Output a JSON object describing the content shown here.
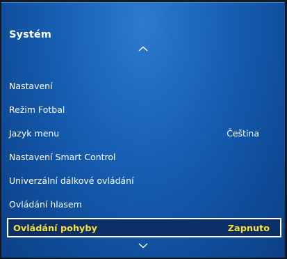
{
  "menu": {
    "title": "Systém",
    "items": [
      {
        "label": "Nastavení",
        "value": ""
      },
      {
        "label": "Režim Fotbal",
        "value": ""
      },
      {
        "label": "Jazyk menu",
        "value": "Čeština"
      },
      {
        "label": "Nastavení Smart Control",
        "value": ""
      },
      {
        "label": "Univerzální dálkové ovládání",
        "value": ""
      },
      {
        "label": "Ovládání hlasem",
        "value": ""
      },
      {
        "label": "Ovládání pohyby",
        "value": "Zapnuto",
        "selected": true
      }
    ]
  },
  "icons": {
    "scroll_up": "chevron-up-icon",
    "scroll_down": "chevron-down-icon"
  },
  "colors": {
    "panel_blue": "#1760b5",
    "selected_text": "#f5e13b",
    "selected_bg": "#0b2f66"
  }
}
